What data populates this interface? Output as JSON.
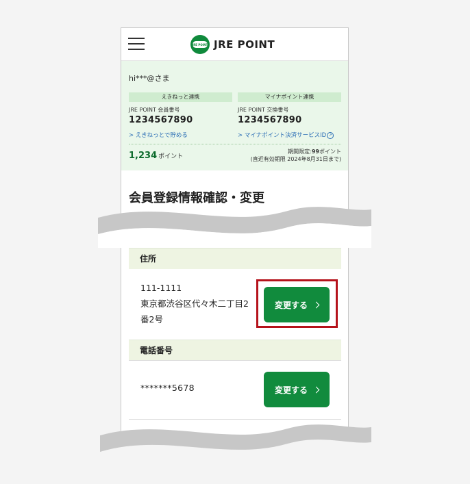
{
  "header": {
    "logo_mark_text": "JRE POINT",
    "logo_text": "JRE POINT"
  },
  "account": {
    "username": "hi***@さま",
    "ekinet": {
      "badge": "えきねっと連携",
      "label": "JRE POINT 会員番号",
      "number": "1234567890",
      "link": "> えきねっとで貯める"
    },
    "mynapoint": {
      "badge": "マイナポイント連携",
      "label": "JRE POINT 交換番号",
      "number": "1234567890",
      "link": "> マイナポイント決済サービスID"
    },
    "points_value": "1,234",
    "points_unit": "ポイント",
    "limit_prefix": "期間限定:",
    "limit_value": "99",
    "limit_unit": "ポイント",
    "limit_expiry": "(直近有効期限 2024年8月31日まで)"
  },
  "page": {
    "title": "会員登録情報確認・変更"
  },
  "address_section": {
    "heading": "住所",
    "postal": "111-1111",
    "line1": "東京都渋谷区代々木二丁目2",
    "line2": "番2号",
    "button_label": "変更する"
  },
  "phone_section": {
    "heading": "電話番号",
    "value": "*******5678",
    "button_label": "変更する"
  },
  "colors": {
    "brand_green": "#118b3d",
    "panel_bg": "#eaf7ea",
    "highlight": "#b5121b"
  },
  "icons": {
    "menu": "hamburger-menu-icon",
    "external": "external-link-icon",
    "chevron": "chevron-right-icon"
  }
}
